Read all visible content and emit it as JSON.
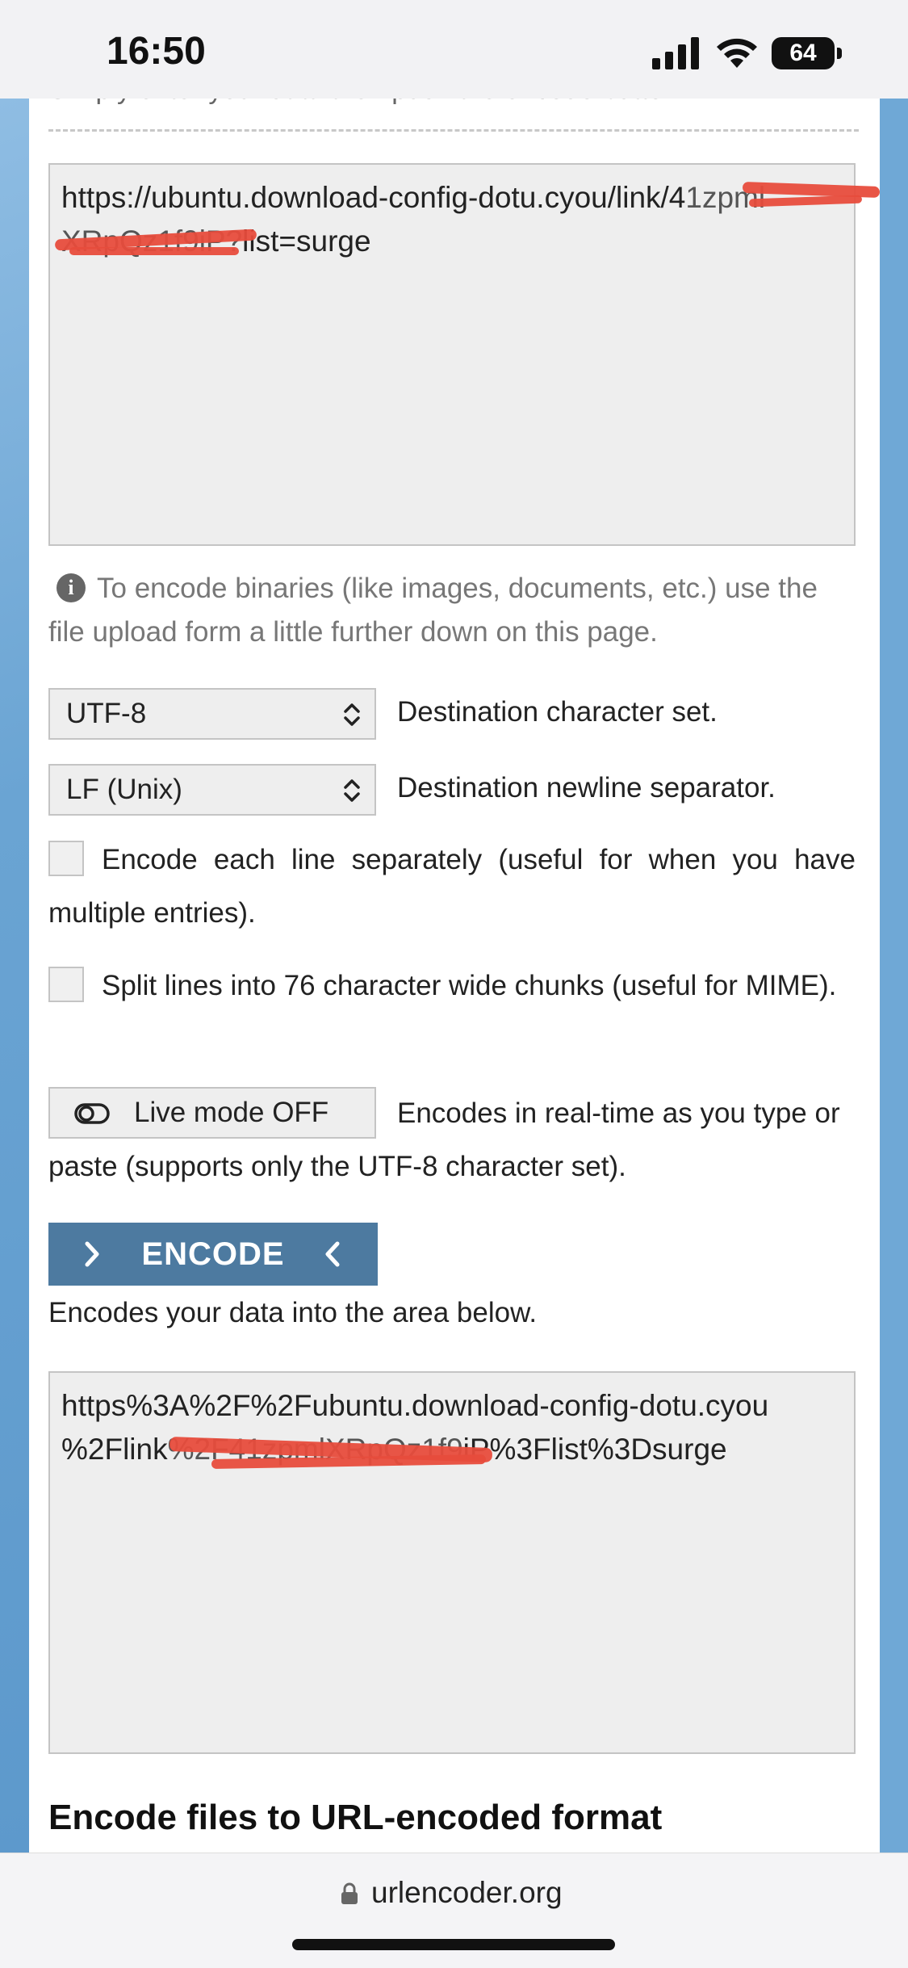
{
  "status_bar": {
    "time": "16:50",
    "battery": "64"
  },
  "input": {
    "line1": "https://ubuntu.download-config-dotu.cyou/link/4",
    "line1_redacted": "1zpml",
    "line2_redacted": "XRpQz1f9iP?",
    "line2": "list=surge",
    "top_cut_text": "Simply enter your data then push the encode button."
  },
  "info": {
    "text": "To encode binaries (like images, documents, etc.) use the file upload form a little further down on this page."
  },
  "charset": {
    "value": "UTF-8",
    "description": "Destination character set."
  },
  "newline": {
    "value": "LF (Unix)",
    "description": "Destination newline separator."
  },
  "options": {
    "each_line": "Encode each line separately (useful for when you have multiple entries).",
    "split_lines": "Split lines into 76 character wide chunks (useful for MIME)."
  },
  "live_mode": {
    "label": "Live mode OFF",
    "description": "Encodes in real-time as you type or paste (supports only the UTF-8 character set)."
  },
  "encode": {
    "label": "ENCODE",
    "description": "Encodes your data into the area below."
  },
  "output": {
    "line1": "https%3A%2F%2Fubuntu.download-config-dotu.cyou",
    "line2_prefix": "%2Flink",
    "line2_redacted": "%2F41zpmlXRpQz1f9",
    "line2_suffix": "iP%3Flist%3Dsurge"
  },
  "section": {
    "title": "Encode files to URL-encoded format"
  },
  "browser": {
    "url": "urlencoder.org"
  },
  "colors": {
    "button": "#4d7aa0",
    "redaction": "#e74c3c",
    "page_bg": "#6fa8d6"
  }
}
